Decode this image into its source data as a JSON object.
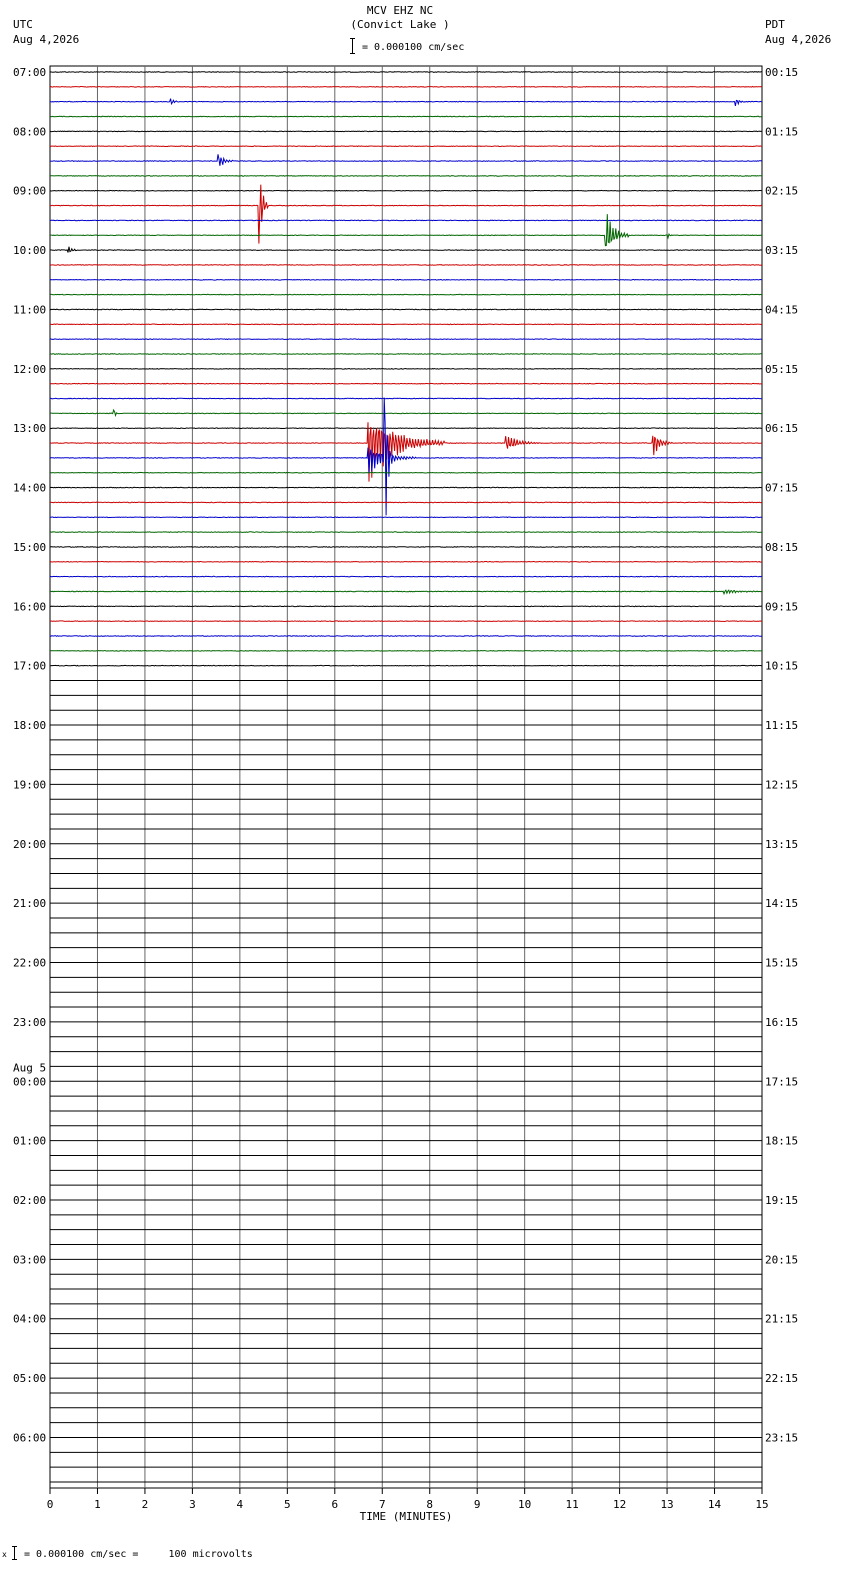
{
  "header": {
    "title": "MCV EHZ NC",
    "subtitle": "(Convict Lake )",
    "scale": "= 0.000100 cm/sec",
    "left_tz": "UTC",
    "left_date": "Aug 4,2026",
    "right_tz": "PDT",
    "right_date": "Aug 4,2026"
  },
  "footer": {
    "mark": "x",
    "text": "= 0.000100 cm/sec =     100 microvolts"
  },
  "chart_data": {
    "type": "line",
    "title": "MCV EHZ NC",
    "xlabel": "TIME (MINUTES)",
    "xlim": [
      0,
      15
    ],
    "x_ticks": [
      "0",
      "1",
      "2",
      "3",
      "4",
      "5",
      "6",
      "7",
      "8",
      "9",
      "10",
      "11",
      "12",
      "13",
      "14",
      "15"
    ],
    "left_labels": [
      "07:00",
      "08:00",
      "09:00",
      "10:00",
      "11:00",
      "12:00",
      "13:00",
      "14:00",
      "15:00",
      "16:00",
      "17:00",
      "18:00",
      "19:00",
      "20:00",
      "21:00",
      "22:00",
      "23:00",
      "00:00",
      "01:00",
      "02:00",
      "03:00",
      "04:00",
      "05:00",
      "06:00"
    ],
    "date_change_label": "Aug 5",
    "right_labels": [
      "00:15",
      "01:15",
      "02:15",
      "03:15",
      "04:15",
      "05:15",
      "06:15",
      "07:15",
      "08:15",
      "09:15",
      "10:15",
      "11:15",
      "12:15",
      "13:15",
      "14:15",
      "15:15",
      "16:15",
      "17:15",
      "18:15",
      "19:15",
      "20:15",
      "21:15",
      "22:15",
      "23:15"
    ],
    "rows_per_hour": 4,
    "total_rows": 96,
    "traced_rows": 41,
    "trace_colors": [
      "#000000",
      "#cc0000",
      "#0000cc",
      "#006600"
    ],
    "events": [
      {
        "row": 2,
        "minute": 2.55,
        "amplitude": 0.25,
        "duration": 0.15
      },
      {
        "row": 2,
        "minute": 14.45,
        "amplitude": 0.3,
        "duration": 0.2
      },
      {
        "row": 6,
        "minute": 3.55,
        "amplitude": 0.6,
        "duration": 0.3
      },
      {
        "row": 9,
        "minute": 4.4,
        "amplitude": 3.5,
        "duration": 0.2
      },
      {
        "row": 11,
        "minute": 11.7,
        "amplitude": 1.8,
        "duration": 0.5
      },
      {
        "row": 11,
        "minute": 13.0,
        "amplitude": 0.3,
        "duration": 0.1
      },
      {
        "row": 12,
        "minute": 0.4,
        "amplitude": 0.3,
        "duration": 0.2
      },
      {
        "row": 23,
        "minute": 1.35,
        "amplitude": 0.4,
        "duration": 0.1
      },
      {
        "row": 25,
        "minute": 6.7,
        "amplitude": 2.6,
        "duration": 1.6
      },
      {
        "row": 25,
        "minute": 9.6,
        "amplitude": 0.6,
        "duration": 0.7
      },
      {
        "row": 25,
        "minute": 12.7,
        "amplitude": 1.1,
        "duration": 0.4
      },
      {
        "row": 26,
        "minute": 6.7,
        "amplitude": 1.2,
        "duration": 1.0
      },
      {
        "row": 26,
        "minute": 7.05,
        "amplitude": 6.5,
        "duration": 0.15
      },
      {
        "row": 35,
        "minute": 14.2,
        "amplitude": 0.15,
        "duration": 1.0
      }
    ]
  }
}
